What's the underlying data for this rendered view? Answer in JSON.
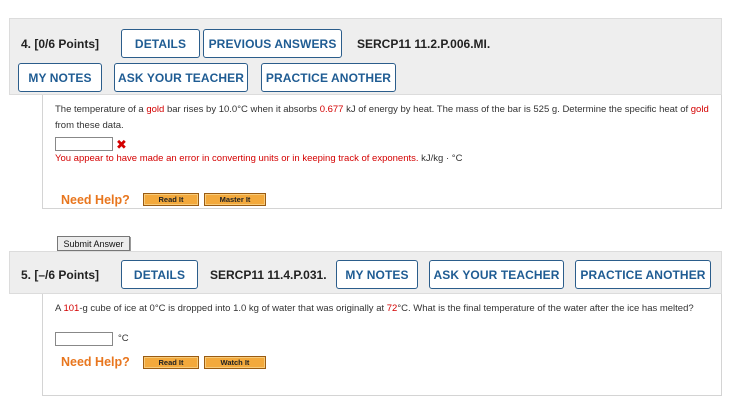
{
  "q4": {
    "number_points": "4. [0/6 Points]",
    "buttons": {
      "details": "DETAILS",
      "previous_answers": "PREVIOUS ANSWERS",
      "my_notes": "MY NOTES",
      "ask_your_teacher": "ASK YOUR TEACHER",
      "practice_another": "PRACTICE ANOTHER"
    },
    "code": "SERCP11 11.2.P.006.MI.",
    "text": {
      "p1": "The temperature of a ",
      "gold1": "gold",
      "p2": " bar rises by 10.0°C when it absorbs ",
      "energy": "0.677",
      "p3": " kJ of energy by heat. The mass of the bar is 525 g. Determine the specific heat of ",
      "gold2": "gold",
      "p4": " from these data."
    },
    "answer_value": "",
    "wrong_mark": "✖",
    "feedback": "You appear to have made an error in converting units or in keeping track of exponents.",
    "unit": "kJ/kg · °C",
    "need_help": "Need Help?",
    "read_it": "Read It",
    "master_it": "Master It",
    "submit": "Submit Answer"
  },
  "q5": {
    "number_points": "5. [–/6 Points]",
    "buttons": {
      "details": "DETAILS",
      "my_notes": "MY NOTES",
      "ask_your_teacher": "ASK YOUR TEACHER",
      "practice_another": "PRACTICE ANOTHER"
    },
    "code": "SERCP11 11.4.P.031.",
    "text": {
      "p1": "A ",
      "mass": "101",
      "p2": "-g cube of ice at 0°C is dropped into 1.0 kg of water that was originally at ",
      "temp": "72",
      "p3": "°C. What is the final temperature of the water after the ice has melted?"
    },
    "answer_value": "",
    "unit": "°C",
    "need_help": "Need Help?",
    "read_it": "Read It",
    "watch_it": "Watch It"
  },
  "colors": {
    "button_text": "#1f5c93",
    "error_red": "#d40000",
    "help_orange": "#e8761e"
  }
}
